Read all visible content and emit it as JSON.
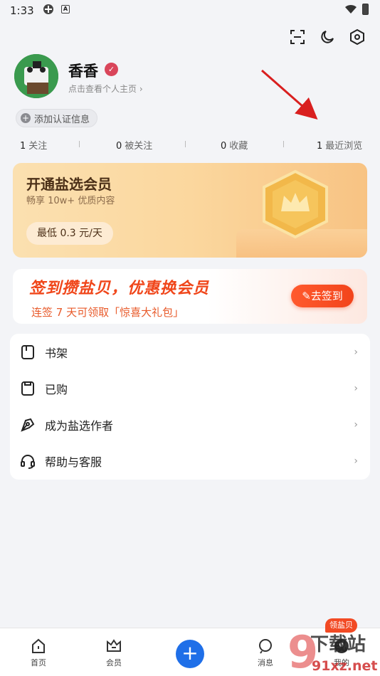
{
  "status_bar": {
    "time": "1:33"
  },
  "profile": {
    "name": "香香",
    "link_text": "点击查看个人主页 ›",
    "cert_chip": "添加认证信息"
  },
  "stats": [
    {
      "num": "1",
      "label": "关注"
    },
    {
      "num": "0",
      "label": "被关注"
    },
    {
      "num": "0",
      "label": "收藏"
    },
    {
      "num": "1",
      "label": "最近浏览"
    }
  ],
  "vip": {
    "title": "开通盐选会员",
    "subtitle": "畅享 10w+ 优质内容",
    "price_button": "最低 0.3 元/天"
  },
  "checkin": {
    "title": "签到攒盐贝，优惠换会员",
    "subtitle": "连签 7 天可领取「惊喜大礼包」",
    "button": "去签到"
  },
  "menu": [
    {
      "label": "书架",
      "icon": "bookshelf-icon"
    },
    {
      "label": "已购",
      "icon": "purchased-icon"
    },
    {
      "label": "成为盐选作者",
      "icon": "pen-icon"
    },
    {
      "label": "帮助与客服",
      "icon": "headset-icon"
    }
  ],
  "menu_chevron": "›",
  "bottom_nav": {
    "home": "首页",
    "vip": "会员",
    "messages": "消息",
    "mine": "我的",
    "reward_badge": "领盐贝"
  },
  "watermark": {
    "line1": "下载站",
    "line2": "91xz.net"
  },
  "colors": {
    "accent_blue": "#1f6fe8",
    "checkin_red": "#f0461a",
    "vip_gold": "#fbd79e"
  }
}
